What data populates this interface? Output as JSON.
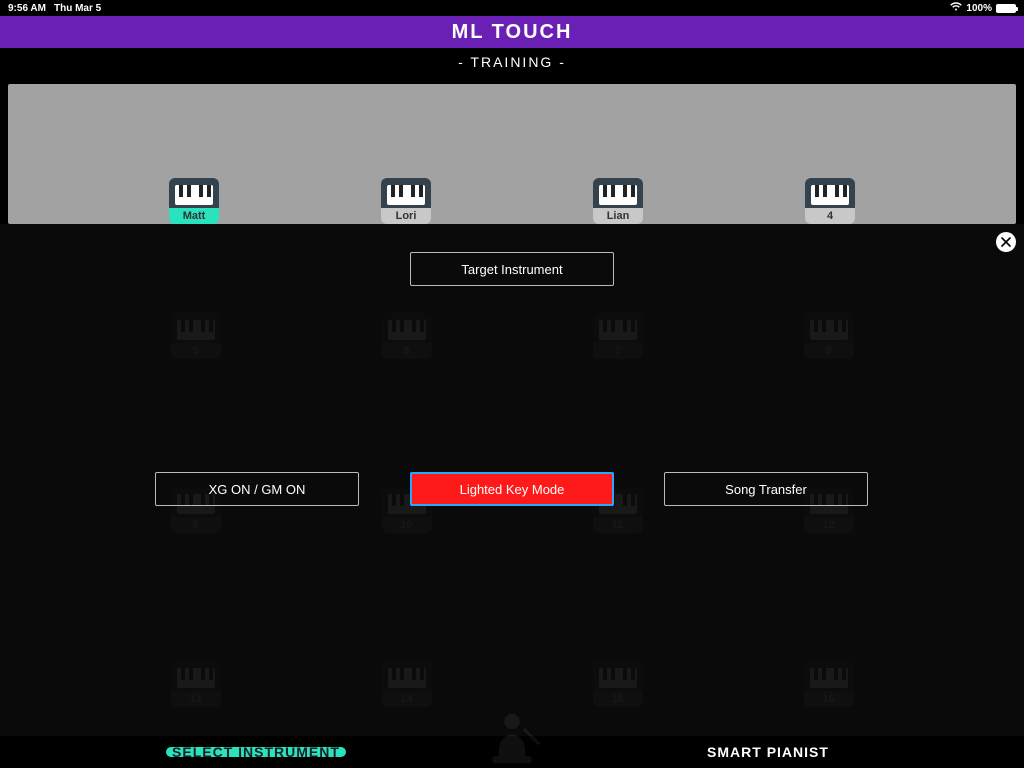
{
  "status": {
    "time": "9:56 AM",
    "day": "Thu Mar 5",
    "wifi_icon": "wifi",
    "battery_pct": "100%"
  },
  "header": {
    "title": "ML TOUCH",
    "subtitle": "- TRAINING -"
  },
  "profiles": [
    {
      "label": "Matt",
      "selected": true
    },
    {
      "label": "Lori",
      "selected": false
    },
    {
      "label": "Lian",
      "selected": false
    },
    {
      "label": "4",
      "selected": false
    }
  ],
  "overlay": {
    "close_icon": "close-icon",
    "target_label": "Target Instrument",
    "buttons": [
      {
        "label": "XG ON / GM ON",
        "active": false
      },
      {
        "label": "Lighted Key Mode",
        "active": true
      },
      {
        "label": "Song Transfer",
        "active": false
      }
    ]
  },
  "dim_grid_labels": [
    "5",
    "6",
    "7",
    "8",
    "9",
    "10",
    "11",
    "12",
    "13",
    "14",
    "15",
    "16"
  ],
  "bottom": {
    "select_instrument": "SELECT INSTRUMENT",
    "smart_pianist": "SMART PIANIST"
  },
  "colors": {
    "accent_purple": "#6a1fb5",
    "accent_teal": "#28e3bd",
    "danger": "#ff1a1a"
  }
}
